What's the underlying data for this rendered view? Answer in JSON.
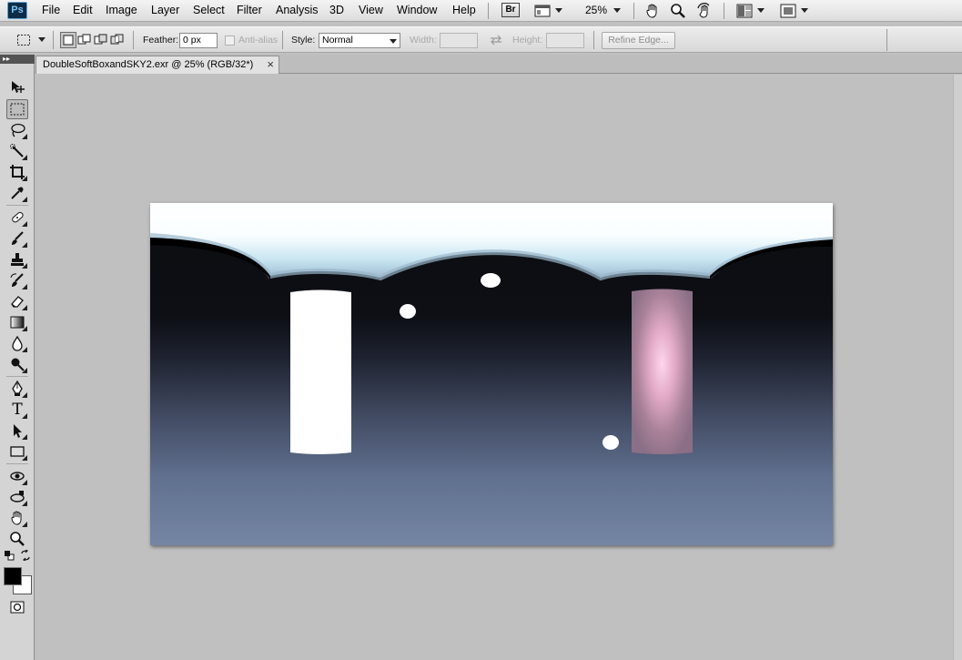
{
  "app": {
    "logo": "Ps",
    "menus": [
      "File",
      "Edit",
      "Image",
      "Layer",
      "Select",
      "Filter",
      "Analysis",
      "3D",
      "View",
      "Window",
      "Help"
    ],
    "bridge_label": "Br",
    "zoom": "25%",
    "icons": [
      "screen-mode-icon",
      "hand-icon",
      "zoom-icon",
      "rotate-view-icon",
      "arrange-documents-icon",
      "screen-mode-icon"
    ]
  },
  "options": {
    "feather_label": "Feather:",
    "feather_value": "0 px",
    "antialias_label": "Anti-alias",
    "style_label": "Style:",
    "style_value": "Normal",
    "width_label": "Width:",
    "height_label": "Height:",
    "refine_edge_label": "Refine Edge..."
  },
  "document": {
    "tab_title": "DoubleSoftBoxandSKY2.exr @ 25% (RGB/32*)",
    "close_glyph": "×"
  },
  "tools": [
    "move-tool",
    "marquee-tool",
    "lasso-tool",
    "quick-selection-tool",
    "crop-tool",
    "eyedropper-tool",
    "healing-brush-tool",
    "brush-tool",
    "clone-stamp-tool",
    "history-brush-tool",
    "eraser-tool",
    "gradient-tool",
    "blur-tool",
    "dodge-tool",
    "pen-tool",
    "type-tool",
    "path-selection-tool",
    "rectangle-tool",
    "3d-rotate-tool",
    "3d-orbit-tool",
    "hand-tool",
    "zoom-tool"
  ],
  "colors": {
    "foreground": "#000000",
    "background": "#ffffff",
    "workspace": "#c0c0c0"
  }
}
